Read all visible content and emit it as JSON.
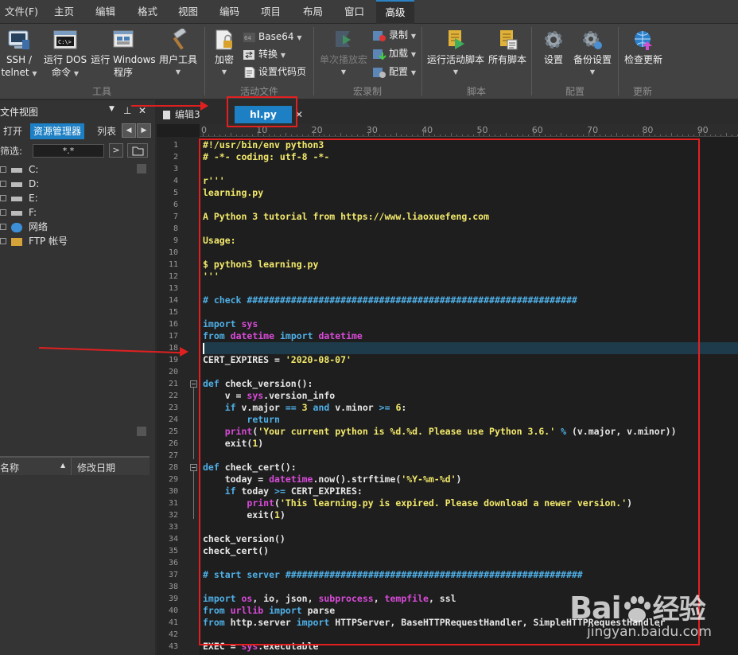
{
  "menu": [
    "文件(F)",
    "主页",
    "编辑",
    "格式",
    "视图",
    "编码",
    "项目",
    "布局",
    "窗口",
    "高级"
  ],
  "ribbon": {
    "ssh_label": "SSH /",
    "ssh_label2": "telnet",
    "dos_label": "运行 DOS",
    "dos_label2": "命令",
    "windows_label": "运行 Windows",
    "windows_label2": "程序",
    "usertools_label": "用户工具",
    "encrypt_label": "加密",
    "base64_label": "Base64",
    "convert_label": "转换",
    "codepage_label": "设置代码页",
    "replay_label": "单次播放宏",
    "record_label": "录制",
    "load_label": "加载",
    "config_label": "配置",
    "run_active_label": "运行活动脚本",
    "all_scripts_label": "所有脚本",
    "settings_label": "设置",
    "backup_label": "备份设置",
    "update_label": "检查更新",
    "groups": [
      "工具",
      "活动文件",
      "宏录制",
      "脚本",
      "配置",
      "更新"
    ]
  },
  "leftpanel": {
    "title": "文件视图",
    "tabs": [
      "打开",
      "资源管理器",
      "列表"
    ],
    "filter_label": "筛选:",
    "filter_value": "*.*",
    "tree": [
      "C:",
      "D:",
      "E:",
      "F:",
      "网络",
      "FTP 帐号"
    ],
    "col_name": "名称",
    "col_date": "修改日期"
  },
  "editor": {
    "tabs": [
      "编辑3",
      "hl.py"
    ],
    "ruler": [
      "0",
      "10",
      "20",
      "30",
      "40",
      "50",
      "60",
      "70",
      "80",
      "90"
    ],
    "cursor_line": 18,
    "lines": [
      [
        [
          "#!/usr/bin/env python3",
          "#f3e96b"
        ]
      ],
      [
        [
          "# -*- coding: utf-8 -*-",
          "#f3e96b"
        ]
      ],
      [],
      [
        [
          "r'''",
          "#f3e96b"
        ]
      ],
      [
        [
          "learning.py",
          "#f3e96b"
        ]
      ],
      [],
      [
        [
          "A Python 3 tutorial from https://www.liaoxuefeng.com",
          "#f3e96b"
        ]
      ],
      [],
      [
        [
          "Usage:",
          "#f3e96b"
        ]
      ],
      [],
      [
        [
          "$ python3 learning.py",
          "#f3e96b"
        ]
      ],
      [
        [
          "'''",
          "#f3e96b"
        ]
      ],
      [],
      [
        [
          "# check ############################################################",
          "#4fb0e8"
        ]
      ],
      [],
      [
        [
          "import",
          "#4fb0e8"
        ],
        [
          " ",
          "#e8e8e8"
        ],
        [
          "sys",
          "#d94bd9"
        ]
      ],
      [
        [
          "from",
          "#4fb0e8"
        ],
        [
          " ",
          "#e8e8e8"
        ],
        [
          "datetime",
          "#d94bd9"
        ],
        [
          " ",
          "#e8e8e8"
        ],
        [
          "import",
          "#4fb0e8"
        ],
        [
          " ",
          "#e8e8e8"
        ],
        [
          "datetime",
          "#d94bd9"
        ]
      ],
      [],
      [
        [
          "CERT_EXPIRES = ",
          "#e8e8e8"
        ],
        [
          "'2020-08-07'",
          "#f3e96b"
        ]
      ],
      [],
      [
        [
          "def",
          "#4fb0e8"
        ],
        [
          " check_version():",
          "#e8e8e8"
        ]
      ],
      [
        [
          "    v = ",
          "#e8e8e8"
        ],
        [
          "sys",
          "#d94bd9"
        ],
        [
          ".version_info",
          "#e8e8e8"
        ]
      ],
      [
        [
          "    ",
          "#e8e8e8"
        ],
        [
          "if",
          "#4fb0e8"
        ],
        [
          " v.major ",
          "#e8e8e8"
        ],
        [
          "==",
          "#4fb0e8"
        ],
        [
          " ",
          "#e8e8e8"
        ],
        [
          "3",
          "#f3e96b"
        ],
        [
          " ",
          "#e8e8e8"
        ],
        [
          "and",
          "#4fb0e8"
        ],
        [
          " v.minor ",
          "#e8e8e8"
        ],
        [
          ">=",
          "#4fb0e8"
        ],
        [
          " ",
          "#e8e8e8"
        ],
        [
          "6",
          "#f3e96b"
        ],
        [
          ":",
          "#e8e8e8"
        ]
      ],
      [
        [
          "        ",
          "#e8e8e8"
        ],
        [
          "return",
          "#4fb0e8"
        ]
      ],
      [
        [
          "    ",
          "#e8e8e8"
        ],
        [
          "print",
          "#d94bd9"
        ],
        [
          "(",
          "#e8e8e8"
        ],
        [
          "'Your current python is %d.%d. Please use Python 3.6.'",
          "#f3e96b"
        ],
        [
          " ",
          "#e8e8e8"
        ],
        [
          "%",
          "#4fb0e8"
        ],
        [
          " (v.major, v.minor))",
          "#e8e8e8"
        ]
      ],
      [
        [
          "    exit(",
          "#e8e8e8"
        ],
        [
          "1",
          "#f3e96b"
        ],
        [
          ")",
          "#e8e8e8"
        ]
      ],
      [],
      [
        [
          "def",
          "#4fb0e8"
        ],
        [
          " check_cert():",
          "#e8e8e8"
        ]
      ],
      [
        [
          "    today = ",
          "#e8e8e8"
        ],
        [
          "datetime",
          "#d94bd9"
        ],
        [
          ".now().strftime(",
          "#e8e8e8"
        ],
        [
          "'%Y-%m-%d'",
          "#f3e96b"
        ],
        [
          ")",
          "#e8e8e8"
        ]
      ],
      [
        [
          "    ",
          "#e8e8e8"
        ],
        [
          "if",
          "#4fb0e8"
        ],
        [
          " today ",
          "#e8e8e8"
        ],
        [
          ">=",
          "#4fb0e8"
        ],
        [
          " CERT_EXPIRES:",
          "#e8e8e8"
        ]
      ],
      [
        [
          "        ",
          "#e8e8e8"
        ],
        [
          "print",
          "#d94bd9"
        ],
        [
          "(",
          "#e8e8e8"
        ],
        [
          "'This learning.py is expired. Please download a newer version.'",
          "#f3e96b"
        ],
        [
          ")",
          "#e8e8e8"
        ]
      ],
      [
        [
          "        exit(",
          "#e8e8e8"
        ],
        [
          "1",
          "#f3e96b"
        ],
        [
          ")",
          "#e8e8e8"
        ]
      ],
      [],
      [
        [
          "check_version()",
          "#e8e8e8"
        ]
      ],
      [
        [
          "check_cert()",
          "#e8e8e8"
        ]
      ],
      [],
      [
        [
          "# start server ######################################################",
          "#4fb0e8"
        ]
      ],
      [],
      [
        [
          "import",
          "#4fb0e8"
        ],
        [
          " ",
          "#e8e8e8"
        ],
        [
          "os",
          "#d94bd9"
        ],
        [
          ", io, json, ",
          "#e8e8e8"
        ],
        [
          "subprocess",
          "#d94bd9"
        ],
        [
          ", ",
          "#e8e8e8"
        ],
        [
          "tempfile",
          "#d94bd9"
        ],
        [
          ", ssl",
          "#e8e8e8"
        ]
      ],
      [
        [
          "from",
          "#4fb0e8"
        ],
        [
          " ",
          "#e8e8e8"
        ],
        [
          "urllib",
          "#d94bd9"
        ],
        [
          " ",
          "#e8e8e8"
        ],
        [
          "import",
          "#4fb0e8"
        ],
        [
          " parse",
          "#e8e8e8"
        ]
      ],
      [
        [
          "from",
          "#4fb0e8"
        ],
        [
          " http.server ",
          "#e8e8e8"
        ],
        [
          "import",
          "#4fb0e8"
        ],
        [
          " HTTPServer, BaseHTTPRequestHandler, SimpleHTTPRequestHandler",
          "#e8e8e8"
        ]
      ],
      [],
      [
        [
          "EXEC = ",
          "#e8e8e8"
        ],
        [
          "sys",
          "#d94bd9"
        ],
        [
          ".executable",
          "#e8e8e8"
        ]
      ]
    ]
  },
  "watermark": {
    "brand_a": "Bai",
    "brand_b": "经验",
    "url": "jingyan.baidu.com"
  }
}
